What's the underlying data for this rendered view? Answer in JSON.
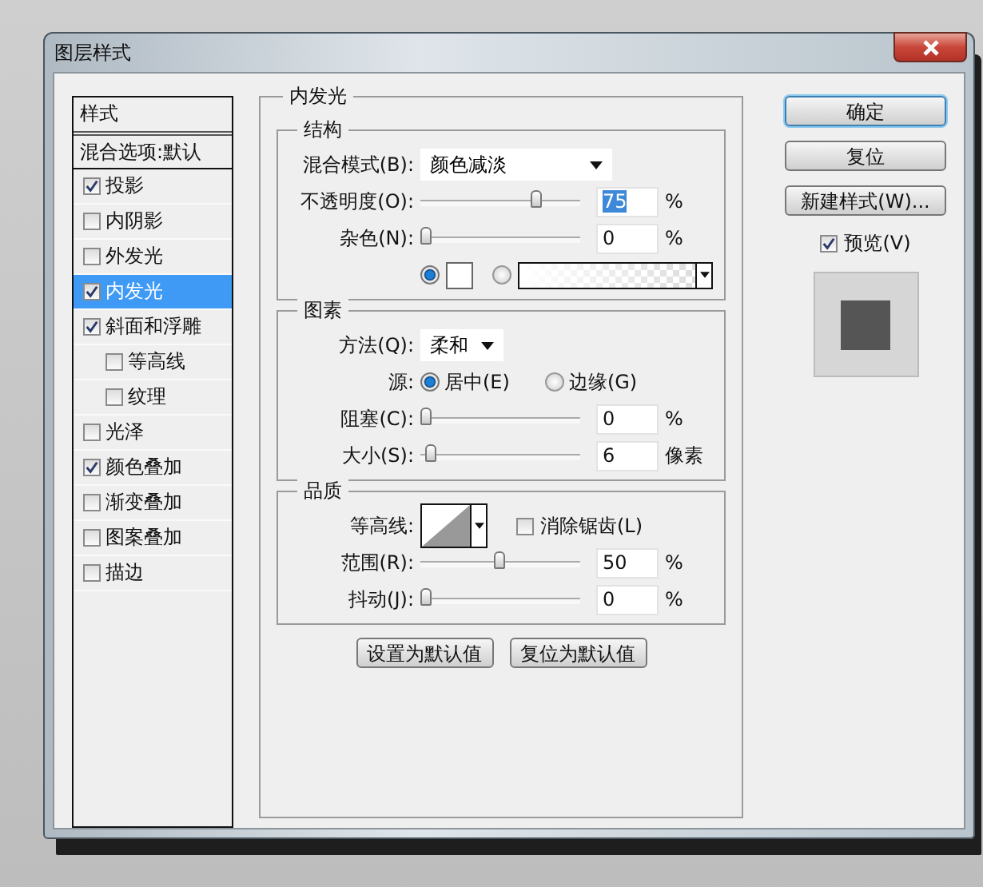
{
  "window": {
    "title": "图层样式"
  },
  "styles_panel": {
    "header": "样式",
    "items": [
      {
        "kind": "header",
        "label": "混合选项:默认",
        "selected": false
      },
      {
        "kind": "check",
        "label": "投影",
        "checked": true,
        "selected": false
      },
      {
        "kind": "check",
        "label": "内阴影",
        "checked": false,
        "selected": false
      },
      {
        "kind": "check",
        "label": "外发光",
        "checked": false,
        "selected": false
      },
      {
        "kind": "check",
        "label": "内发光",
        "checked": true,
        "selected": true
      },
      {
        "kind": "check",
        "label": "斜面和浮雕",
        "checked": true,
        "selected": false,
        "children": [
          {
            "kind": "check",
            "label": "等高线",
            "checked": false,
            "selected": false
          },
          {
            "kind": "check",
            "label": "纹理",
            "checked": false,
            "selected": false
          }
        ]
      },
      {
        "kind": "check",
        "label": "光泽",
        "checked": false,
        "selected": false
      },
      {
        "kind": "check",
        "label": "颜色叠加",
        "checked": true,
        "selected": false
      },
      {
        "kind": "check",
        "label": "渐变叠加",
        "checked": false,
        "selected": false
      },
      {
        "kind": "check",
        "label": "图案叠加",
        "checked": false,
        "selected": false
      },
      {
        "kind": "check",
        "label": "描边",
        "checked": false,
        "selected": false
      }
    ]
  },
  "main": {
    "title": "内发光",
    "sections": [
      {
        "title": "结构",
        "rows": [
          {
            "kind": "select",
            "label": "混合模式(B):",
            "value": "颜色减淡"
          },
          {
            "kind": "slider",
            "label": "不透明度(O):",
            "level": 0.75,
            "value": "75",
            "value_selected": true,
            "unit": "%"
          },
          {
            "kind": "slider",
            "label": "杂色(N):",
            "level": 0,
            "value": "0",
            "value_selected": false,
            "unit": "%"
          },
          {
            "kind": "color",
            "options": [
              {
                "kind": "swatch",
                "selected": true
              },
              {
                "kind": "gradient",
                "selected": false
              }
            ]
          }
        ]
      },
      {
        "title": "图素",
        "rows": [
          {
            "kind": "select",
            "label": "方法(Q):",
            "value": "柔和"
          },
          {
            "kind": "radio",
            "label": "源:",
            "options": [
              {
                "label": "居中(E)",
                "selected": true
              },
              {
                "label": "边缘(G)",
                "selected": false
              }
            ]
          },
          {
            "kind": "slider",
            "label": "阻塞(C):",
            "level": 0,
            "value": "0",
            "value_selected": false,
            "unit": "%"
          },
          {
            "kind": "slider",
            "label": "大小(S):",
            "level": 0.03,
            "value": "6",
            "value_selected": false,
            "unit": "像素"
          }
        ]
      },
      {
        "title": "品质",
        "rows": [
          {
            "kind": "contour",
            "label": "等高线:",
            "checkbox": {
              "label": "消除锯齿(L)",
              "checked": false
            }
          },
          {
            "kind": "slider",
            "label": "范围(R):",
            "level": 0.5,
            "value": "50",
            "value_selected": false,
            "unit": "%"
          },
          {
            "kind": "slider",
            "label": "抖动(J):",
            "level": 0,
            "value": "0",
            "value_selected": false,
            "unit": "%"
          }
        ]
      }
    ],
    "buttons": [
      "设置为默认值",
      "复位为默认值"
    ]
  },
  "actions": [
    {
      "label": "确定",
      "default": true
    },
    {
      "label": "复位",
      "default": false
    },
    {
      "label": "新建样式(W)...",
      "default": false
    }
  ],
  "preview": {
    "label": "预览(V)",
    "checked": true
  }
}
